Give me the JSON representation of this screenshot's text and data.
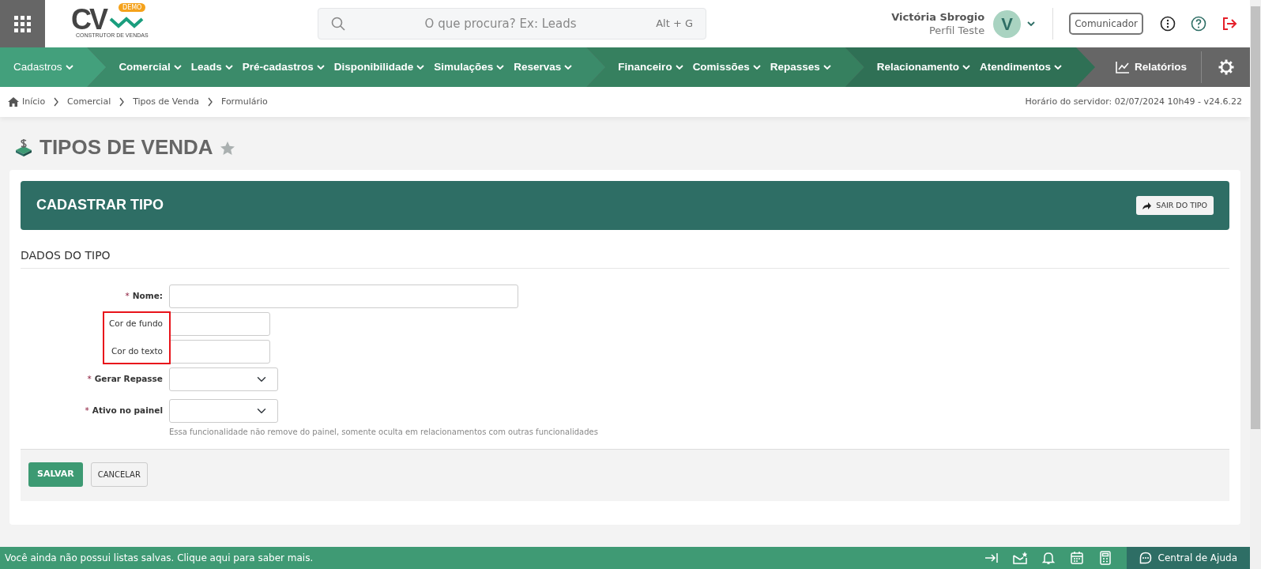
{
  "header": {
    "logo": {
      "text": "CV",
      "badge": "DEMO",
      "tagline": "CONSTRUTOR DE VENDAS"
    },
    "search": {
      "placeholder": "O que procura? Ex: Leads",
      "shortcut": "Alt + G"
    },
    "user": {
      "name": "Victória Sbrogio",
      "profile": "Perfil Teste",
      "initial": "V"
    },
    "communicator": "Comunicador"
  },
  "nav_groups": [
    {
      "items": [
        "Cadastros"
      ]
    },
    {
      "items": [
        "Comercial",
        "Leads",
        "Pré-cadastros",
        "Disponibilidade",
        "Simulações",
        "Reservas"
      ]
    },
    {
      "items": [
        "Financeiro",
        "Comissões",
        "Repasses"
      ]
    },
    {
      "items": [
        "Relacionamento",
        "Atendimentos"
      ]
    }
  ],
  "reports": "Relatórios",
  "breadcrumb": [
    "Início",
    "Comercial",
    "Tipos de Venda",
    "Formulário"
  ],
  "server_time": "Horário do servidor: 02/07/2024 10h49 - v24.6.22",
  "page_title": "TIPOS DE VENDA",
  "card": {
    "title": "CADASTRAR TIPO",
    "exit_button": "SAIR DO TIPO",
    "section": "DADOS DO TIPO"
  },
  "form": {
    "required_marker": "*",
    "fields": [
      {
        "label": "Nome:",
        "kind": "text",
        "required": true,
        "highlighted": false
      },
      {
        "label": "Cor de fundo",
        "kind": "color",
        "required": false,
        "highlighted": true
      },
      {
        "label": "Cor do texto",
        "kind": "color",
        "required": false,
        "highlighted": true
      },
      {
        "label": "Gerar Repasse",
        "kind": "select",
        "required": true,
        "highlighted": false
      },
      {
        "label": "Ativo no painel",
        "kind": "select",
        "required": true,
        "highlighted": false,
        "hint": "Essa funcionalidade não remove do painel, somente oculta em relacionamentos com outras funcionalidades"
      }
    ]
  },
  "actions": {
    "save": "SALVAR",
    "cancel": "CANCELAR"
  },
  "footer": {
    "message": "Você ainda não possui listas salvas. Clique aqui para saber mais.",
    "help": "Central de Ajuda"
  }
}
